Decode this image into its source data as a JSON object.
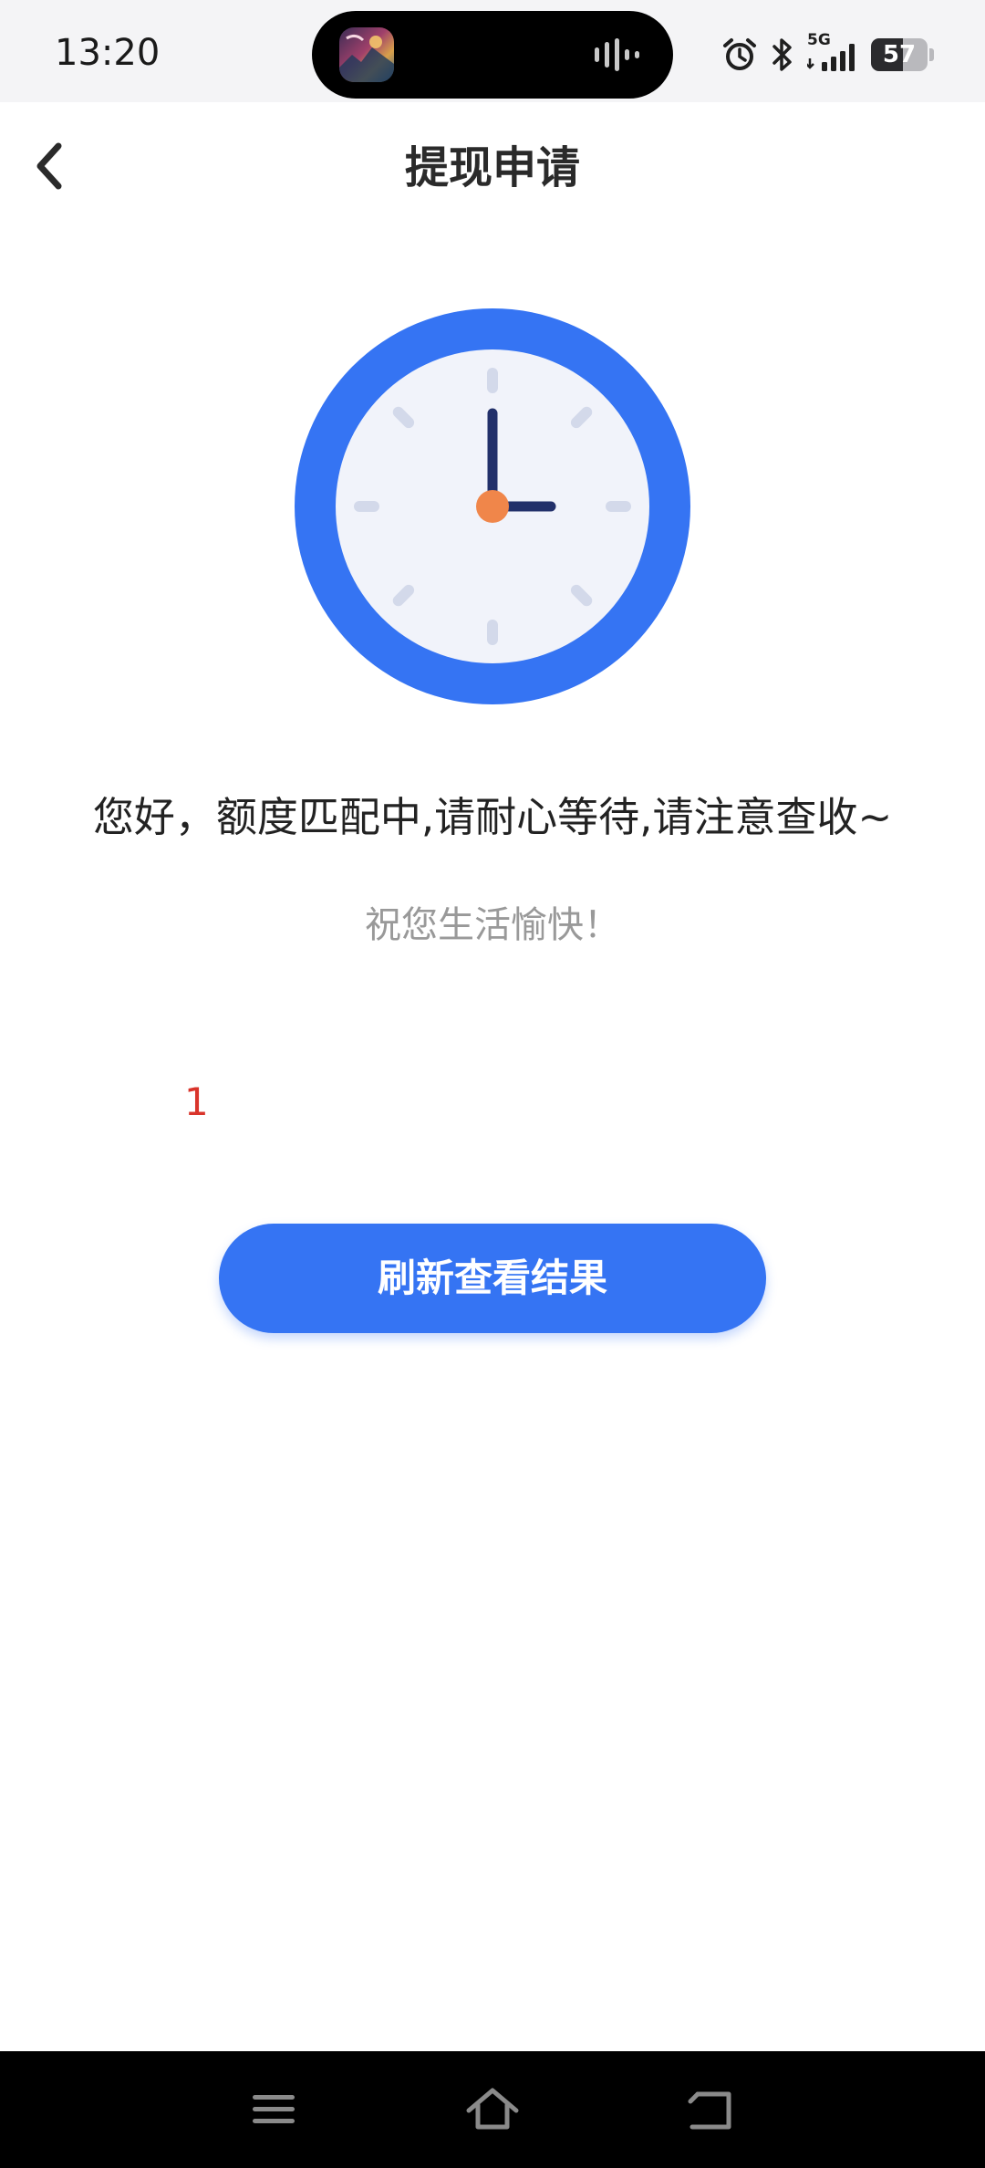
{
  "status_bar": {
    "time": "13:20",
    "network": "5G",
    "battery": "57",
    "battery_level": 0.57,
    "icons": [
      "media-thumbnail-icon",
      "audio-wave-icon",
      "alarm-icon",
      "bluetooth-icon",
      "signal-icon",
      "battery-icon"
    ]
  },
  "header": {
    "title": "提现申请",
    "back_icon": "chevron-left-icon"
  },
  "illustration": {
    "icon": "clock-icon",
    "ring_color": "#3574f3",
    "face_color": "#f1f3fa",
    "hand_color": "#22306a",
    "pivot_color": "#f0864a",
    "tick_color": "#d3d9ea"
  },
  "main": {
    "message": "您好，额度匹配中,请耐心等待,请注意查收~",
    "sub_message": "祝您生活愉快！",
    "counter": "1",
    "refresh_label": "刷新查看结果"
  },
  "colors": {
    "accent": "#3574f3",
    "counter": "#d9342b",
    "sub_text": "#999999"
  },
  "nav_bar": {
    "buttons": [
      "menu-icon",
      "home-icon",
      "back-icon"
    ]
  }
}
